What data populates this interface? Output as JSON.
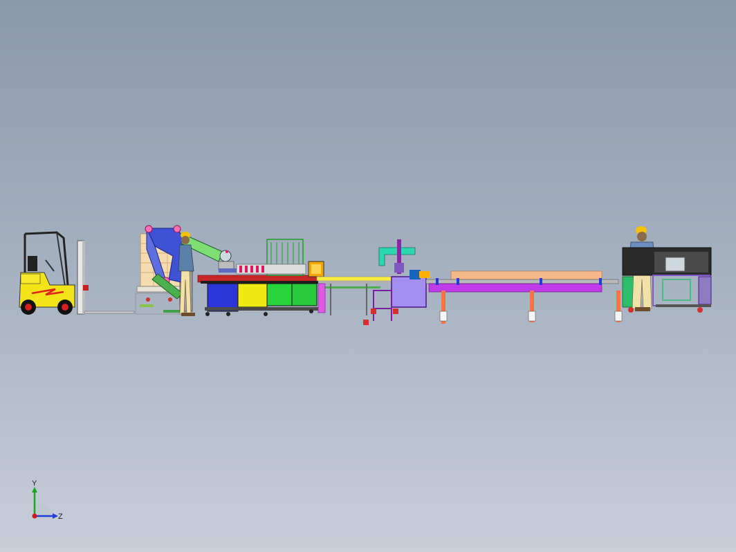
{
  "scene": {
    "background_top": "#8a99ab",
    "background_bottom": "#c9ced9",
    "components": [
      "forklift",
      "pallet-stack",
      "palletizing-robot-arm",
      "operator-figure",
      "filling-machine",
      "capping-station",
      "labeling-station",
      "long-conveyor",
      "packing-machine",
      "control-cabinet"
    ]
  },
  "triad": {
    "y_label": "Y",
    "z_label": "Z",
    "y_color": "#19a81e",
    "z_color": "#1e3ddb",
    "origin_color": "#d01818"
  }
}
